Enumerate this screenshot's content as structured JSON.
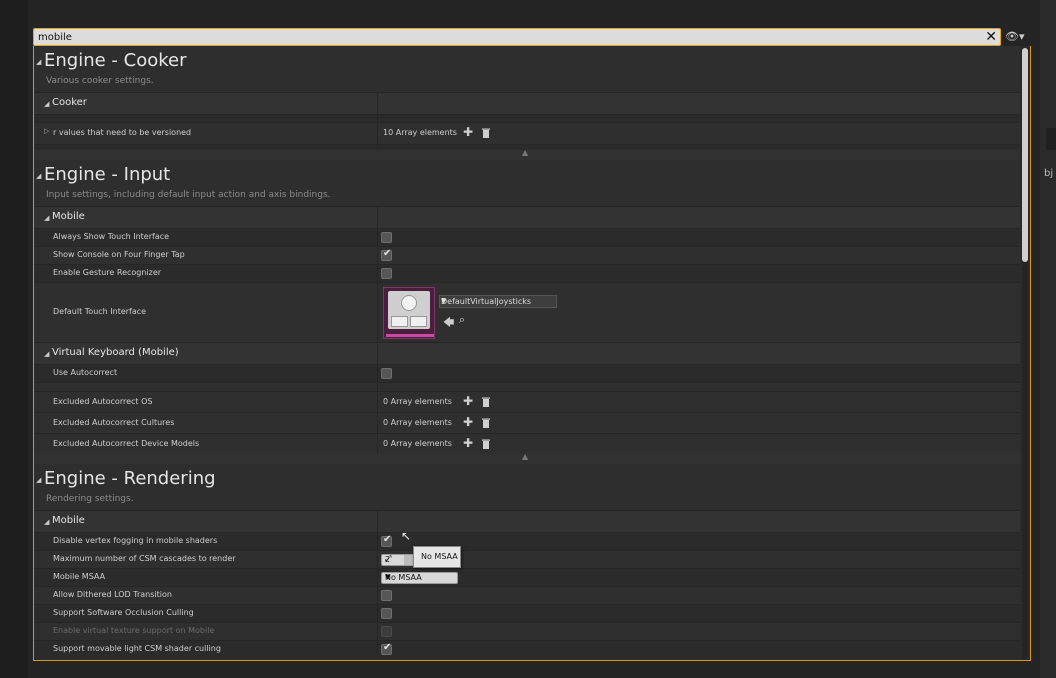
{
  "search": {
    "value": "mobile",
    "clear_glyph": "✕",
    "visibility_glyph": "👁▾"
  },
  "right_strip": {
    "text": "bj"
  },
  "sections": {
    "cooker": {
      "title": "Engine - Cooker",
      "description": "Various cooker settings.",
      "category": "Cooker",
      "rows": [
        {
          "label": "r values that need to be versioned",
          "value": "10 Array elements"
        }
      ]
    },
    "input": {
      "title": "Engine - Input",
      "description": "Input settings, including default input action and axis bindings.",
      "category_mobile": "Mobile",
      "mobile_rows": [
        {
          "label": "Always Show Touch Interface",
          "checked": false
        },
        {
          "label": "Show Console on Four Finger Tap",
          "checked": true
        },
        {
          "label": "Enable Gesture Recognizer",
          "checked": false
        }
      ],
      "default_touch": {
        "label": "Default Touch Interface",
        "asset": "DefaultVirtualJoysticks"
      },
      "category_keyboard": "Virtual Keyboard (Mobile)",
      "keyboard_rows": [
        {
          "label": "Use Autocorrect",
          "checked": false
        }
      ],
      "array_rows": [
        {
          "label": "Excluded Autocorrect OS",
          "value": "0 Array elements"
        },
        {
          "label": "Excluded Autocorrect Cultures",
          "value": "0 Array elements"
        },
        {
          "label": "Excluded Autocorrect Device Models",
          "value": "0 Array elements"
        }
      ]
    },
    "rendering": {
      "title": "Engine - Rendering",
      "description": "Rendering settings.",
      "category": "Mobile",
      "rows": {
        "vertex_fog": {
          "label": "Disable vertex fogging in mobile shaders",
          "checked": true
        },
        "csm": {
          "label": "Maximum number of CSM cascades to render",
          "value": "2"
        },
        "msaa": {
          "label": "Mobile MSAA",
          "value": "No MSAA"
        },
        "dither": {
          "label": "Allow Dithered LOD Transition",
          "checked": false
        },
        "occlusion": {
          "label": "Support Software Occlusion Culling",
          "checked": false
        },
        "vt": {
          "label": "Enable virtual texture support on Mobile",
          "checked": false
        },
        "movable": {
          "label": "Support movable light CSM shader culling",
          "checked": true
        }
      },
      "msaa_popup": "No MSAA"
    }
  },
  "colors": {
    "accent": "#e9a61a",
    "panel": "#2b2b2b",
    "thumbnail_bar": "#c94aa3"
  }
}
